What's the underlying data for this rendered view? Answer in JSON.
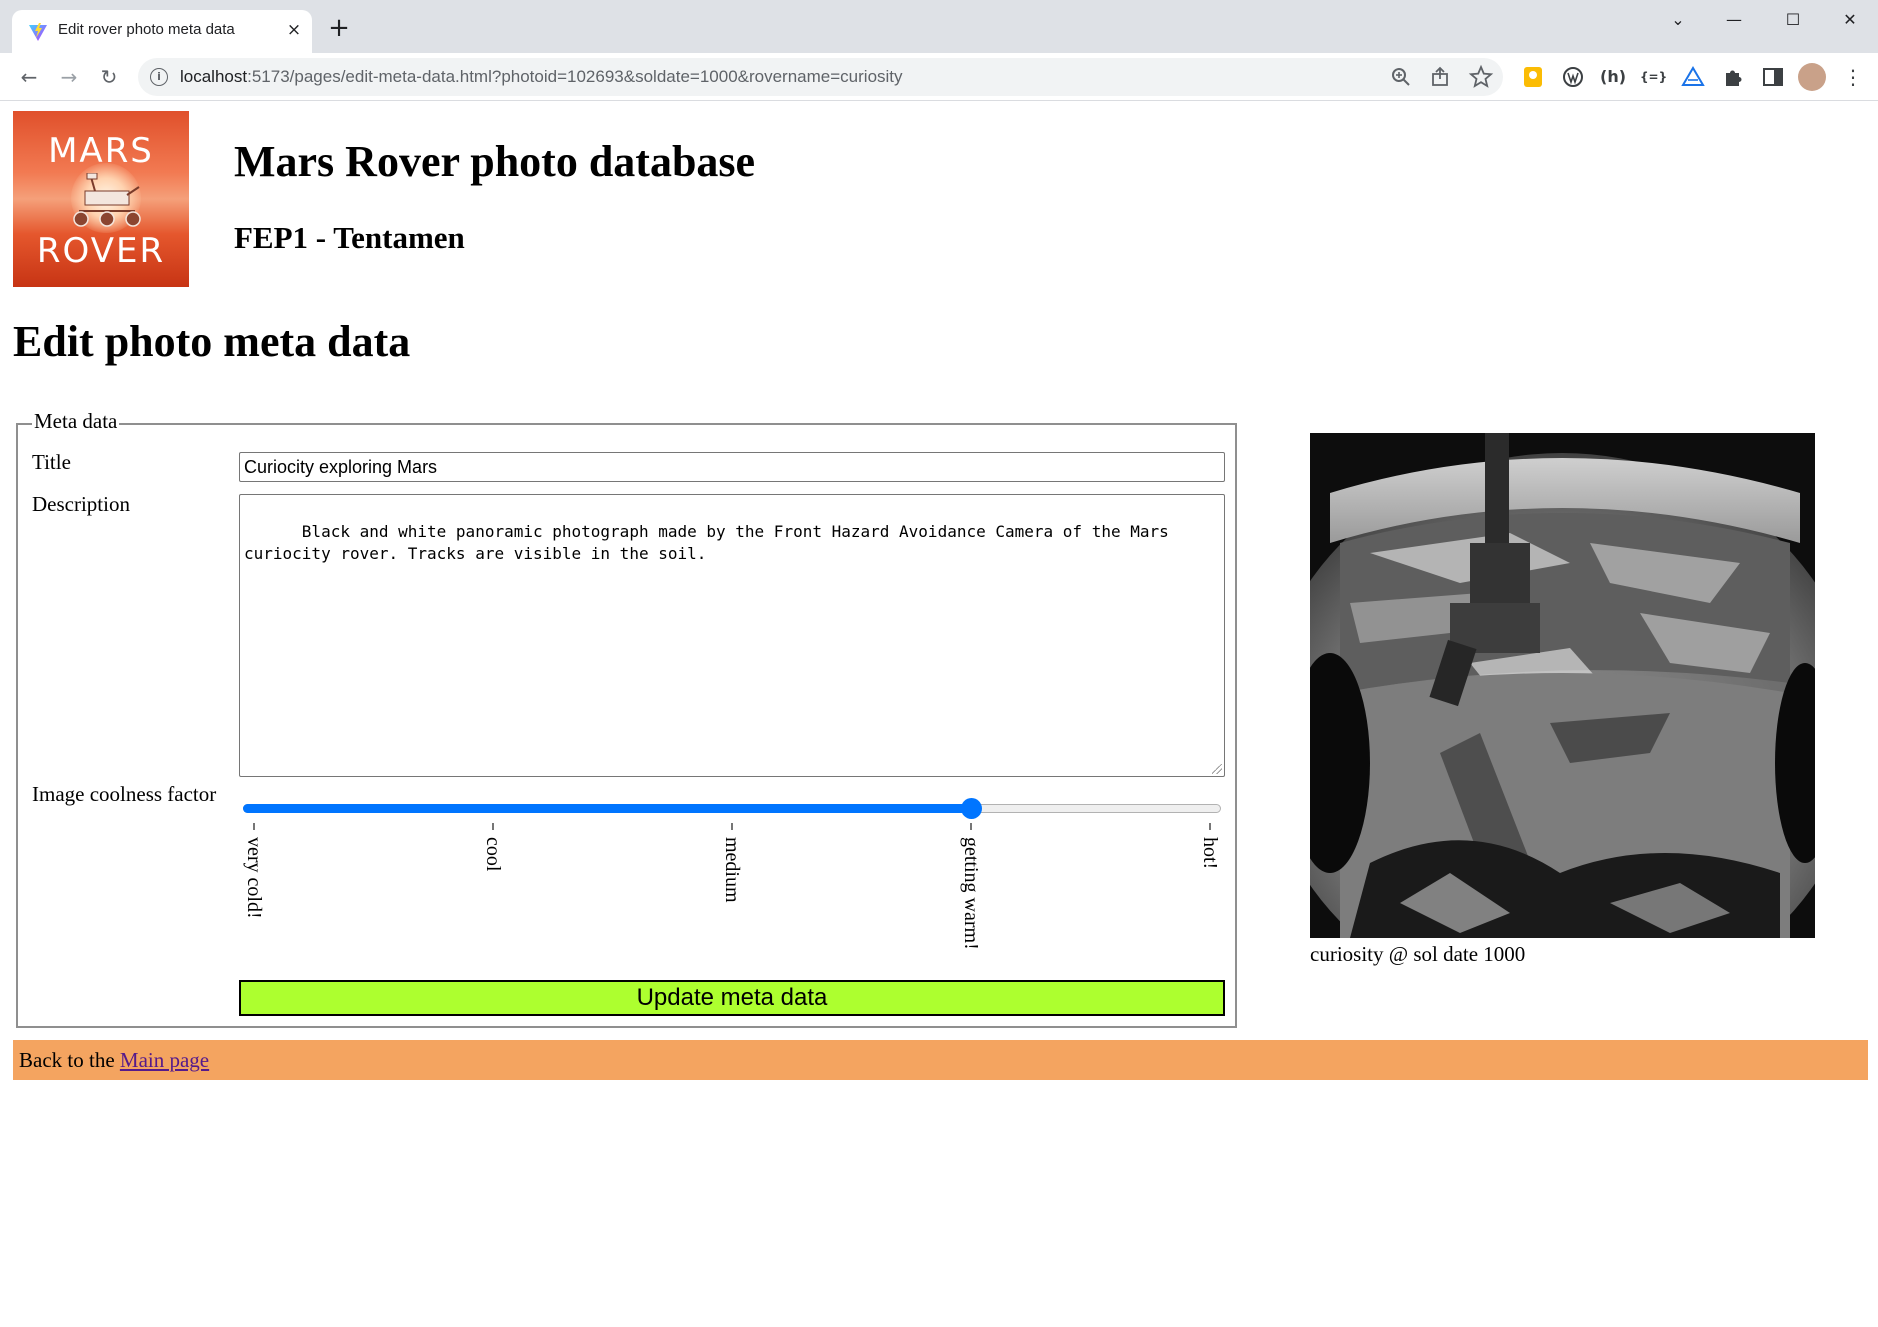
{
  "browser": {
    "tab_title": "Edit rover photo meta data",
    "tab_close_icon": "×",
    "new_tab_icon": "+",
    "url_host": "localhost",
    "url_rest": ":5173/pages/edit-meta-data.html?photoid=102693&soldate=1000&rovername=curiosity",
    "window_controls": [
      "⌄",
      "—",
      "☐",
      "✕"
    ],
    "nav": {
      "back": "←",
      "forward": "→",
      "reload": "↻"
    },
    "omnibox_icons": [
      "zoom-icon",
      "share-icon",
      "star-icon"
    ],
    "extension_icons": [
      "keep-icon",
      "wordpress-icon",
      "hook-icon",
      "json-icon",
      "drive-icon",
      "puzzle-icon",
      "sidepanel-icon",
      "profile-avatar",
      "menu-icon"
    ]
  },
  "header": {
    "logo_top": "MARS",
    "logo_bottom": "ROVER",
    "title": "Mars Rover photo database",
    "subtitle": "FEP1 - Tentamen"
  },
  "page_title": "Edit photo meta data",
  "form": {
    "legend": "Meta data",
    "title_label": "Title",
    "title_value": "Curiocity exploring Mars",
    "description_label": "Description",
    "description_value": "Black and white panoramic photograph made by the Front Hazard Avoidance Camera of the Mars\ncuriocity rover. Tracks are visible in the soil.",
    "coolness_label": "Image coolness factor",
    "coolness_value": 4,
    "coolness_min": 1,
    "coolness_max": 5,
    "coolness_options": [
      "very cold!",
      "cool",
      "medium",
      "getting warm!",
      "hot!"
    ],
    "submit_label": "Update meta data",
    "submit_color": "#adff2f"
  },
  "photo": {
    "caption": "curiosity @ sol date 1000"
  },
  "footer": {
    "text": "Back to the ",
    "link_label": "Main page",
    "background": "#f4a460"
  }
}
